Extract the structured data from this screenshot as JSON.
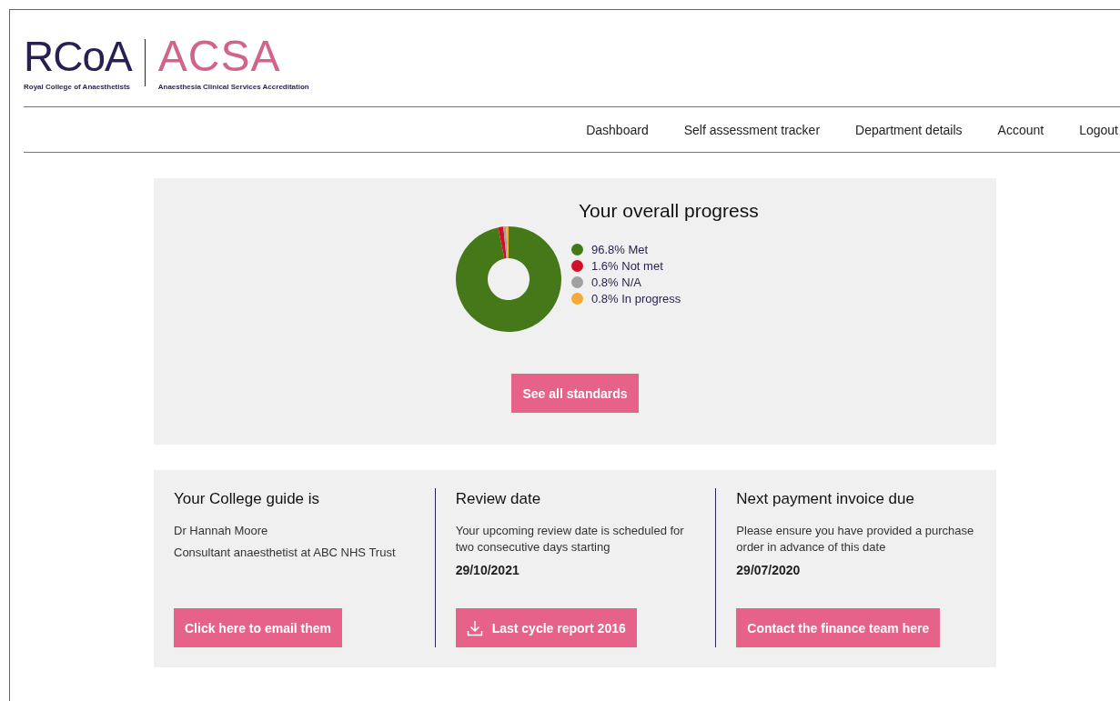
{
  "logo": {
    "college_mark": "RCoA",
    "college_name": "Royal College of Anaesthetists",
    "scheme_mark": "ACSA",
    "scheme_name": "Anaesthesia Clinical Services Accreditation"
  },
  "nav": [
    {
      "label": "Dashboard"
    },
    {
      "label": "Self assessment tracker"
    },
    {
      "label": "Department details"
    },
    {
      "label": "Account"
    },
    {
      "label": "Logout"
    }
  ],
  "progress": {
    "title": "Your overall progress",
    "chart_data": {
      "type": "donut",
      "values": [
        96.8,
        1.6,
        0.8,
        0.8
      ]
    },
    "legend": [
      {
        "label": "96.8% Met",
        "color": "#447818"
      },
      {
        "label": "1.6% Not met",
        "color": "#d0112b"
      },
      {
        "label": "0.8% N/A",
        "color": "#a0a0a0"
      },
      {
        "label": "0.8% In progress",
        "color": "#f5a937"
      }
    ],
    "button": "See all standards"
  },
  "cards": [
    {
      "title": "Your College guide is",
      "lines": [
        "Dr Hannah Moore",
        "Consultant anaesthetist at ABC NHS Trust"
      ],
      "button": {
        "label": "Click here to email them",
        "kind": "plain"
      }
    },
    {
      "title": "Review date",
      "lines": [
        "Your upcoming review date is scheduled for two consecutive days starting"
      ],
      "date": "29/10/2021",
      "button": {
        "label": "Last cycle report 2016",
        "kind": "download"
      }
    },
    {
      "title": "Next payment invoice due",
      "lines": [
        "Please ensure you have provided a purchase order in advance of this date"
      ],
      "date": "29/07/2020",
      "button": {
        "label": "Contact the finance team here",
        "kind": "plain"
      }
    }
  ]
}
